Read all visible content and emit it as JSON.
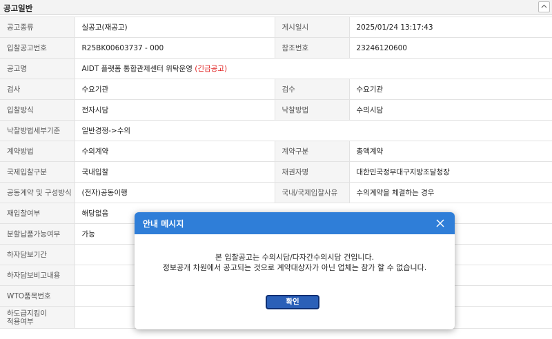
{
  "section": {
    "title": "공고일반"
  },
  "rows": [
    [
      "공고종류",
      "실공고(재공고)",
      "게시일시",
      "2025/01/24 13:17:43"
    ],
    [
      "입찰공고번호",
      "R25BK00603737 - 000",
      "참조번호",
      "23246120600"
    ],
    [
      "공고명",
      "AIDT 플랫폼 통합관제센터 위탁운영",
      "(긴급공고)"
    ],
    [
      "검사",
      "수요기관",
      "검수",
      "수요기관"
    ],
    [
      "입찰방식",
      "전자시담",
      "낙찰방법",
      "수의시담"
    ],
    [
      "낙찰방법세부기준",
      "일반경쟁->수의"
    ],
    [
      "계약방법",
      "수의계약",
      "계약구분",
      "총액계약"
    ],
    [
      "국제입찰구분",
      "국내입찰",
      "채권자명",
      "대한민국정부대구지방조달청장"
    ],
    [
      "공동계약 및 구성방식",
      "(전자)공동이행",
      "국내/국제입찰사유",
      "수의계약을 체결하는 경우"
    ],
    [
      "재입찰여부",
      "해당없음"
    ],
    [
      "분할납품가능여부",
      "가능"
    ],
    [
      "하자담보기간",
      ""
    ],
    [
      "하자담보비고내용",
      ""
    ],
    [
      "WTO품목번호",
      ""
    ],
    [
      "하도급지킴이 적용여부",
      ""
    ]
  ],
  "labels": {
    "r0a": "공고종류",
    "r0b": "게시일시",
    "r1a": "입찰공고번호",
    "r1b": "참조번호",
    "r2a": "공고명",
    "r3a": "검사",
    "r3b": "검수",
    "r4a": "입찰방식",
    "r4b": "낙찰방법",
    "r5a": "낙찰방법세부기준",
    "r6a": "계약방법",
    "r6b": "계약구분",
    "r7a": "국제입찰구분",
    "r7b": "채권자명",
    "r8a": "공동계약 및 구성방식",
    "r8b": "국내/국제입찰사유",
    "r9a": "재입찰여부",
    "r10a": "분할납품가능여부",
    "r11a": "하자담보기간",
    "r12a": "하자담보비고내용",
    "r13a": "WTO품목번호",
    "r14a_1": "하도급지킴이",
    "r14a_2": "적용여부"
  },
  "values": {
    "r0a": "실공고(재공고)",
    "r0b": "2025/01/24 13:17:43",
    "r1a": "R25BK00603737 - 000",
    "r1b": "23246120600",
    "r2a": "AIDT 플랫폼 통합관제센터 위탁운영",
    "r2urgent": "(긴급공고)",
    "r3a": "수요기관",
    "r3b": "수요기관",
    "r4a": "전자시담",
    "r4b": "수의시담",
    "r5a": "일반경쟁->수의",
    "r6a": "수의계약",
    "r6b": "총액계약",
    "r7a": "국내입찰",
    "r7b": "대한민국정부대구지방조달청장",
    "r8a": "(전자)공동이행",
    "r8b": "수의계약을 체결하는 경우",
    "r9a": "해당없음",
    "r10a": "가능"
  },
  "modal": {
    "title": "안내 메시지",
    "message_line1": "본 입찰공고는 수의시담/다자간수의시담 건입니다.",
    "message_line2": "정보공개 차원에서 공고되는 것으로 계약대상자가 아닌 업체는 참가 할 수 없습니다.",
    "ok_label": "확인"
  },
  "colors": {
    "modal_header": "#2f7ed8",
    "ok_button": "#2b60b8",
    "urgent": "#e02020"
  },
  "icons": {
    "collapse": "chevron-up-icon",
    "close": "close-icon"
  }
}
